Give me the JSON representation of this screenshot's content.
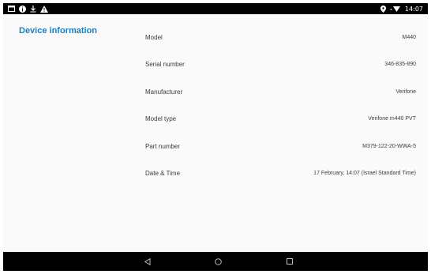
{
  "status_bar": {
    "time": "14:07",
    "left_icons": [
      "window-icon",
      "info-icon",
      "download-icon",
      "warning-icon"
    ],
    "right_icons": [
      "location-icon",
      "wifi-icon"
    ]
  },
  "sidebar": {
    "title": "Device information"
  },
  "info": {
    "rows": [
      {
        "label": "Model",
        "value": "M440"
      },
      {
        "label": "Serial number",
        "value": "346-835-890"
      },
      {
        "label": "Manufacturer",
        "value": "Verifone"
      },
      {
        "label": "Model type",
        "value": "Verifone m440 PVT"
      },
      {
        "label": "Part number",
        "value": "M379-122-20-WWA-5"
      },
      {
        "label": "Date & Time",
        "value": "17 February, 14:07 (Israel Standard Time)"
      }
    ]
  },
  "nav_bar": {
    "buttons": [
      "back-icon",
      "home-icon",
      "recents-icon"
    ]
  }
}
